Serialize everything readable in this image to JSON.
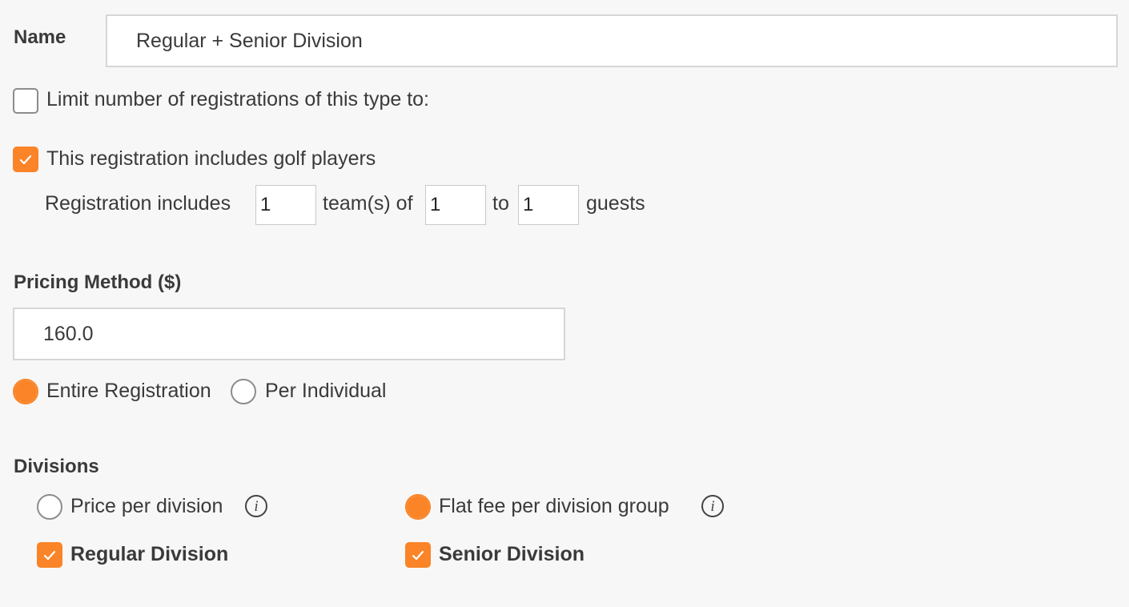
{
  "name_field": {
    "label": "Name",
    "value": "Regular + Senior Division"
  },
  "limit_registrations": {
    "checked": false,
    "label": "Limit number of registrations of this type to:"
  },
  "golf_players": {
    "checked": true,
    "label": "This registration includes golf players",
    "sentence_prefix": "Registration includes",
    "teams_value": "1",
    "teams_of_text": "team(s) of",
    "min_guests_value": "1",
    "to_text": "to",
    "max_guests_value": "1",
    "guests_text": "guests"
  },
  "pricing": {
    "label": "Pricing Method ($)",
    "value": "160.0",
    "options": [
      {
        "label": "Entire Registration",
        "selected": true
      },
      {
        "label": "Per Individual",
        "selected": false
      }
    ]
  },
  "divisions": {
    "label": "Divisions",
    "pricing_options": [
      {
        "label": "Price per division",
        "selected": false,
        "info_icon": "i"
      },
      {
        "label": "Flat fee per division group",
        "selected": true,
        "info_icon": "i"
      }
    ],
    "items": [
      {
        "label": "Regular Division",
        "checked": true
      },
      {
        "label": "Senior Division",
        "checked": true
      }
    ]
  },
  "colors": {
    "accent": "#fa8427",
    "background": "#f7f7f7",
    "text": "#3a3a3a"
  },
  "icons": {
    "checkmark": "checkmark-icon",
    "info": "info-icon"
  }
}
